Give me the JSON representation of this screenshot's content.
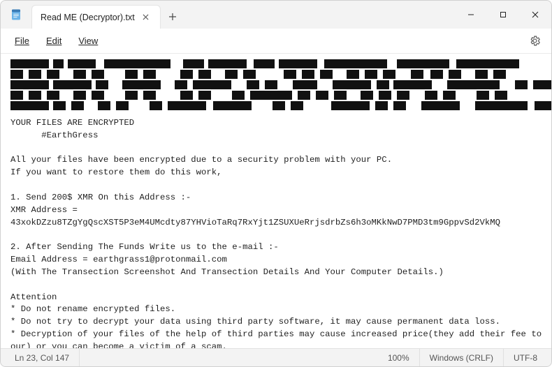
{
  "tab": {
    "title": "Read ME (Decryptor).txt"
  },
  "menu": {
    "file": "File",
    "edit": "Edit",
    "view": "View"
  },
  "body": {
    "l1": "YOUR FILES ARE ENCRYPTED",
    "l2": "      #EarthGress",
    "l3": "",
    "l4": "All your files have been encrypted due to a security problem with your PC.",
    "l5": "If you want to restore them do this work,",
    "l6": "",
    "l7": "1. Send 200$ XMR On this Address :-",
    "l8": "XMR Address =",
    "l9": "43xokDZzu8TZgYgQscXST5P3eM4UMcdty87YHVioTaRq7RxYjt1ZSUXUeRrjsdrbZs6h3oMKkNwD7PMD3tm9GppvSd2VkMQ",
    "l10": "",
    "l11": "2. After Sending The Funds Write us to the e-mail :-",
    "l12": "Email Address = earthgrass1@protonmail.com",
    "l13": "(With The Transection Screenshot And Transection Details And Your Computer Details.)",
    "l14": "",
    "l15": "Attention",
    "l16": "* Do not rename encrypted files.",
    "l17": "* Do not try to decrypt your data using third party software, it may cause permanent data loss.",
    "l18": "* Decryption of your files of the help of third parties may cause increased price(they add their fee to",
    "l19": "our) or you can become a victim of a scam."
  },
  "status": {
    "pos": "Ln 23, Col 147",
    "zoom": "100%",
    "eol": "Windows (CRLF)",
    "enc": "UTF-8"
  }
}
